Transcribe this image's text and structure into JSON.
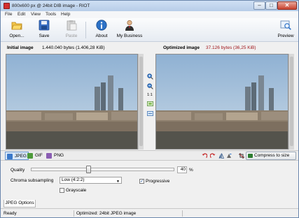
{
  "window": {
    "title": "800x600 px @ 24bit  DIB image - RIOT"
  },
  "menu": [
    "File",
    "Edit",
    "View",
    "Tools",
    "Help"
  ],
  "toolbar": {
    "open": "Open...",
    "save": "Save",
    "paste": "Paste",
    "about": "About",
    "business": "My Business",
    "preview": "Preview"
  },
  "info": {
    "initial_label": "Initial image",
    "initial_value": "1.440.040 bytes (1.406,28 KiB)",
    "optimized_label": "Optimized image",
    "optimized_value": "37.126 bytes (36,25 KiB)"
  },
  "middle_tools": {
    "one_to_one": "1:1"
  },
  "formats": {
    "jpeg": "JPEG",
    "gif": "GIF",
    "png": "PNG"
  },
  "compress_button": "Compress to size",
  "options": {
    "quality_label": "Quality",
    "quality_value": "40",
    "quality_unit": "%",
    "quality_fraction": 0.4,
    "chroma_label": "Chroma subsampling",
    "chroma_value": "Low (4:2:2)",
    "progressive_label": "Progressive",
    "progressive_checked": true,
    "grayscale_label": "Grayscale",
    "grayscale_checked": false
  },
  "bottom_tab": "JPEG Options",
  "status": {
    "left": "Ready",
    "middle": "Optimized: 24bit JPEG image"
  },
  "icons": [
    "app-icon",
    "open-icon",
    "save-icon",
    "paste-icon",
    "about-icon",
    "business-icon",
    "preview-icon",
    "zoom-in-icon",
    "zoom-out-icon",
    "fit-icon",
    "sync-icon",
    "undo-icon",
    "redo-icon",
    "flip-icon",
    "rotate-icon",
    "crop-icon",
    "compress-icon"
  ]
}
